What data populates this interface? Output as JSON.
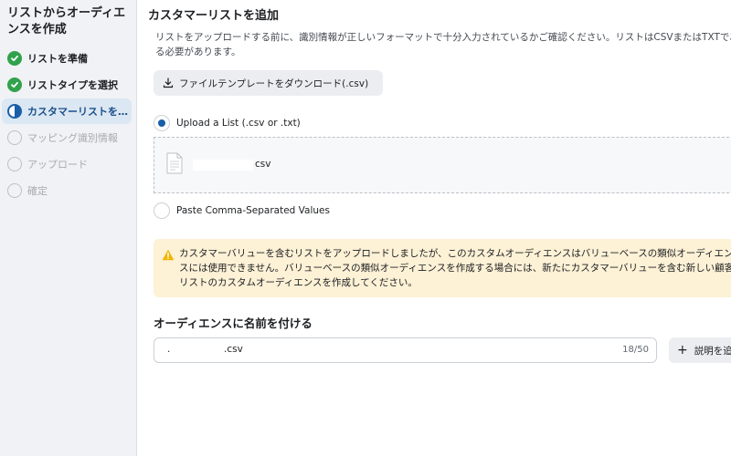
{
  "sidebar": {
    "title": "リストからオーディエンスを作成",
    "steps": [
      {
        "label": "リストを準備",
        "state": "done"
      },
      {
        "label": "リストタイプを選択",
        "state": "done"
      },
      {
        "label": "カスタマーリストを…",
        "state": "current"
      },
      {
        "label": "マッピング識別情報",
        "state": "pending"
      },
      {
        "label": "アップロード",
        "state": "pending"
      },
      {
        "label": "確定",
        "state": "pending"
      }
    ]
  },
  "main": {
    "title": "カスタマーリストを追加",
    "description": "リストをアップロードする前に、識別情報が正しいフォーマットで十分入力されているかご確認ください。リストはCSVまたはTXTである必要があります。",
    "download_button": "ファイルテンプレートをダウンロード(.csv)",
    "upload_option": "Upload a List (.csv or .txt)",
    "file_name_suffix": "csv",
    "paste_option": "Paste Comma-Separated Values",
    "warning": "カスタマーバリューを含むリストをアップロードしましたが、このカスタムオーディエンスはバリューベースの類似オーディエンスには使用できません。バリューベースの類似オーディエンスを作成する場合には、新たにカスタマーバリューを含む新しい顧客リストのカスタムオーディエンスを作成してください。",
    "name_section_title": "オーディエンスに名前を付ける",
    "name_prefix": ".",
    "name_suffix": ".csv",
    "name_count": "18/50",
    "add_description_button": "説明を追加"
  },
  "colors": {
    "accent": "#1a5fa8",
    "done": "#31a24c",
    "warning_bg": "#fdf1d6",
    "warning_icon": "#f0b400"
  }
}
